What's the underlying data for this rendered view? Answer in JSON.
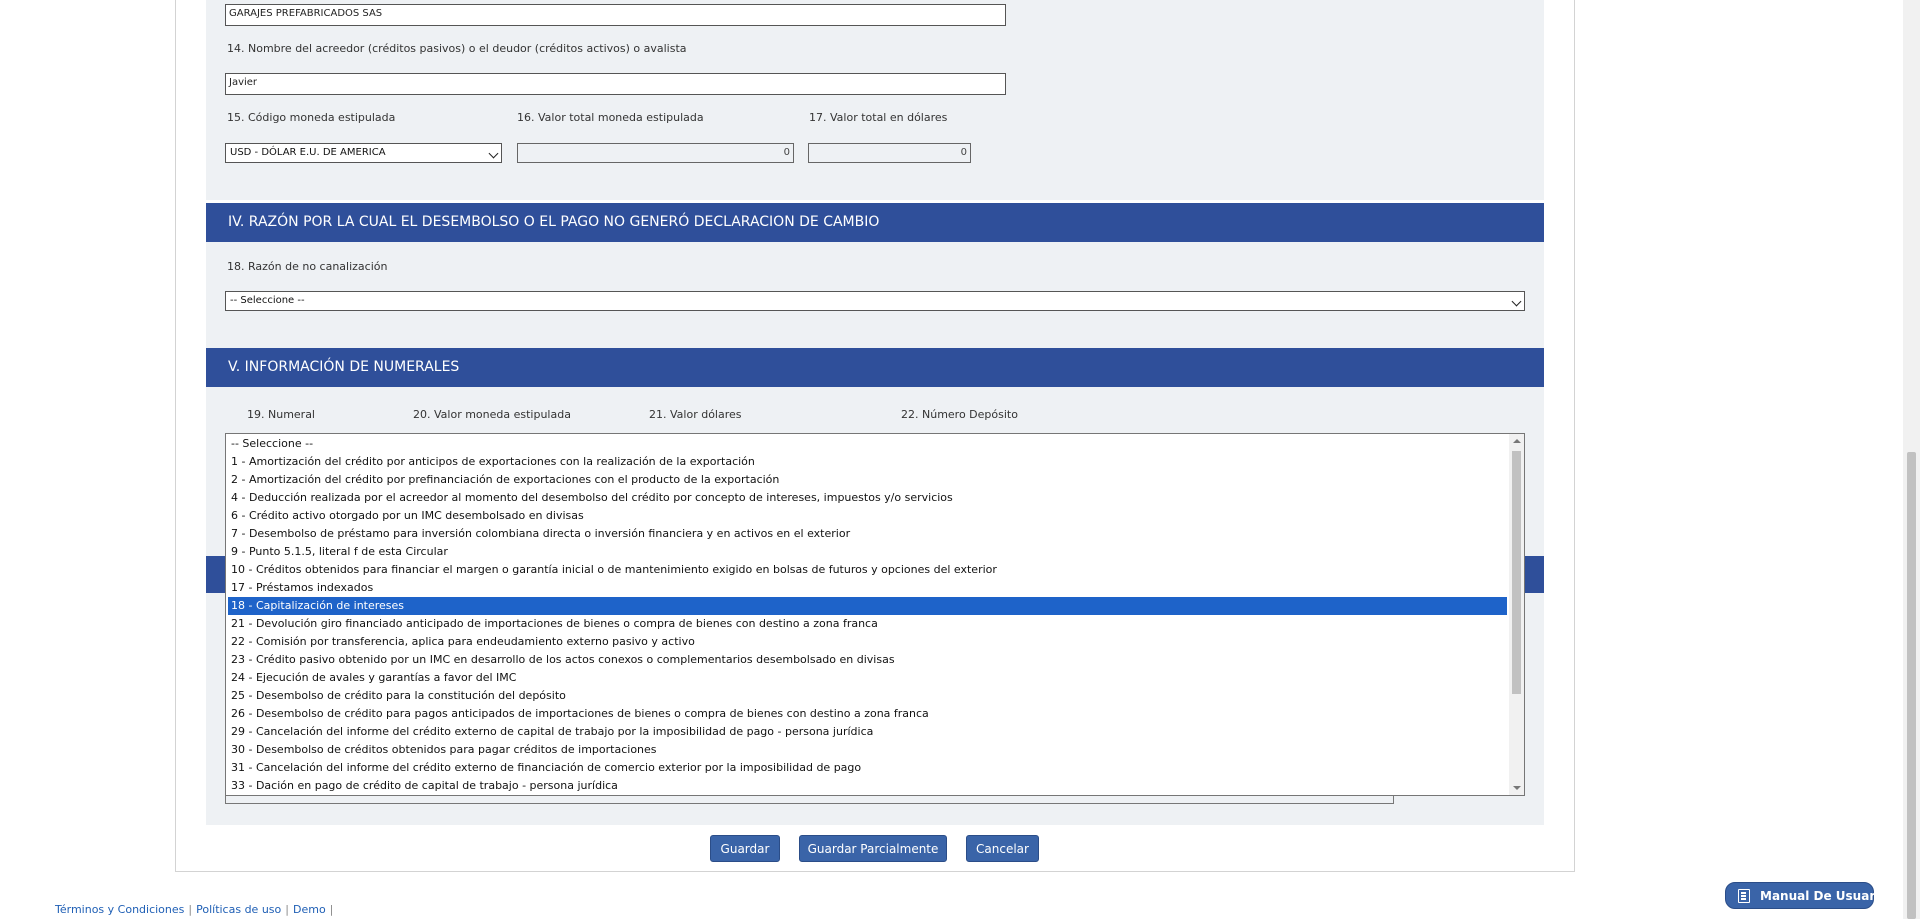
{
  "fields": {
    "empresa_value": "GARAJES PREFABRICADOS SAS",
    "acreedor_label": "14. Nombre del acreedor (créditos pasivos) o el deudor (créditos activos) o avalista",
    "acreedor_value": "Javier",
    "codigo_moneda_label": "15. Código moneda estipulada",
    "codigo_moneda_selected": "USD - DÓLAR E.U. DE AMERICA",
    "valor_total_label": "16. Valor total moneda estipulada",
    "valor_total_value": "0",
    "valor_dolares_label": "17. Valor total en dólares",
    "valor_dolares_value": "0"
  },
  "section4": {
    "title": "IV. RAZÓN POR LA CUAL EL DESEMBOLSO O EL PAGO NO GENERÓ DECLARACION DE CAMBIO",
    "razon_label": "18. Razón de no canalización",
    "razon_selected": "-- Seleccione --"
  },
  "section5": {
    "title": "V. INFORMACIÓN DE NUMERALES",
    "columns": [
      "19. Numeral",
      "20. Valor moneda estipulada",
      "21. Valor dólares",
      "22. Número Depósito"
    ]
  },
  "numeral_list": {
    "options": [
      "-- Seleccione --",
      "1 - Amortización del crédito por anticipos de exportaciones con la realización de la exportación",
      "2 - Amortización del crédito por prefinanciación de exportaciones con el producto de la exportación",
      "4 - Deducción realizada por el acreedor al momento del desembolso del crédito por concepto de intereses, impuestos y/o servicios",
      "6 - Crédito activo otorgado por un IMC desembolsado en divisas",
      "7 - Desembolso de préstamo para inversión colombiana directa o inversión financiera y en activos en el exterior",
      "9 - Punto 5.1.5, literal f de esta Circular",
      "10 - Créditos obtenidos para financiar el margen o garantía inicial o de mantenimiento exigido en bolsas de futuros y opciones del exterior",
      "17 - Préstamos indexados",
      "18 - Capitalización de intereses",
      "21 - Devolución giro financiado anticipado de importaciones de bienes o compra de bienes con destino a zona franca",
      "22 - Comisión por transferencia, aplica para endeudamiento externo pasivo y activo",
      "23 - Crédito pasivo obtenido por un IMC en desarrollo de los actos conexos o complementarios desembolsado en divisas",
      "24 - Ejecución de avales y garantías a favor del IMC",
      "25 - Desembolso de crédito para la constitución del depósito",
      "26 - Desembolso de crédito para pagos anticipados de importaciones de bienes o compra de bienes con destino a zona franca",
      "29 - Cancelación del informe del crédito externo de capital de trabajo por la imposibilidad de pago - persona jurídica",
      "30 - Desembolso de créditos obtenidos para pagar créditos de importaciones",
      "31 - Cancelación del informe del crédito externo de financiación de comercio exterior por la imposibilidad de pago",
      "33 - Dación en pago de crédito de capital de trabajo - persona jurídica"
    ],
    "selected_index": 9
  },
  "actions": {
    "guardar": "Guardar",
    "guardar_parcial": "Guardar Parcialmente",
    "cancelar": "Cancelar"
  },
  "footer": {
    "terminos": "Términos y Condiciones",
    "politicas": "Políticas de uso",
    "demo": "Demo",
    "manual": "Manual De Usuario"
  },
  "colors": {
    "section_header": "#2f4f9a",
    "selected_option": "#1e63c9",
    "button": "#3a64a8",
    "panel": "#eef1f4"
  }
}
